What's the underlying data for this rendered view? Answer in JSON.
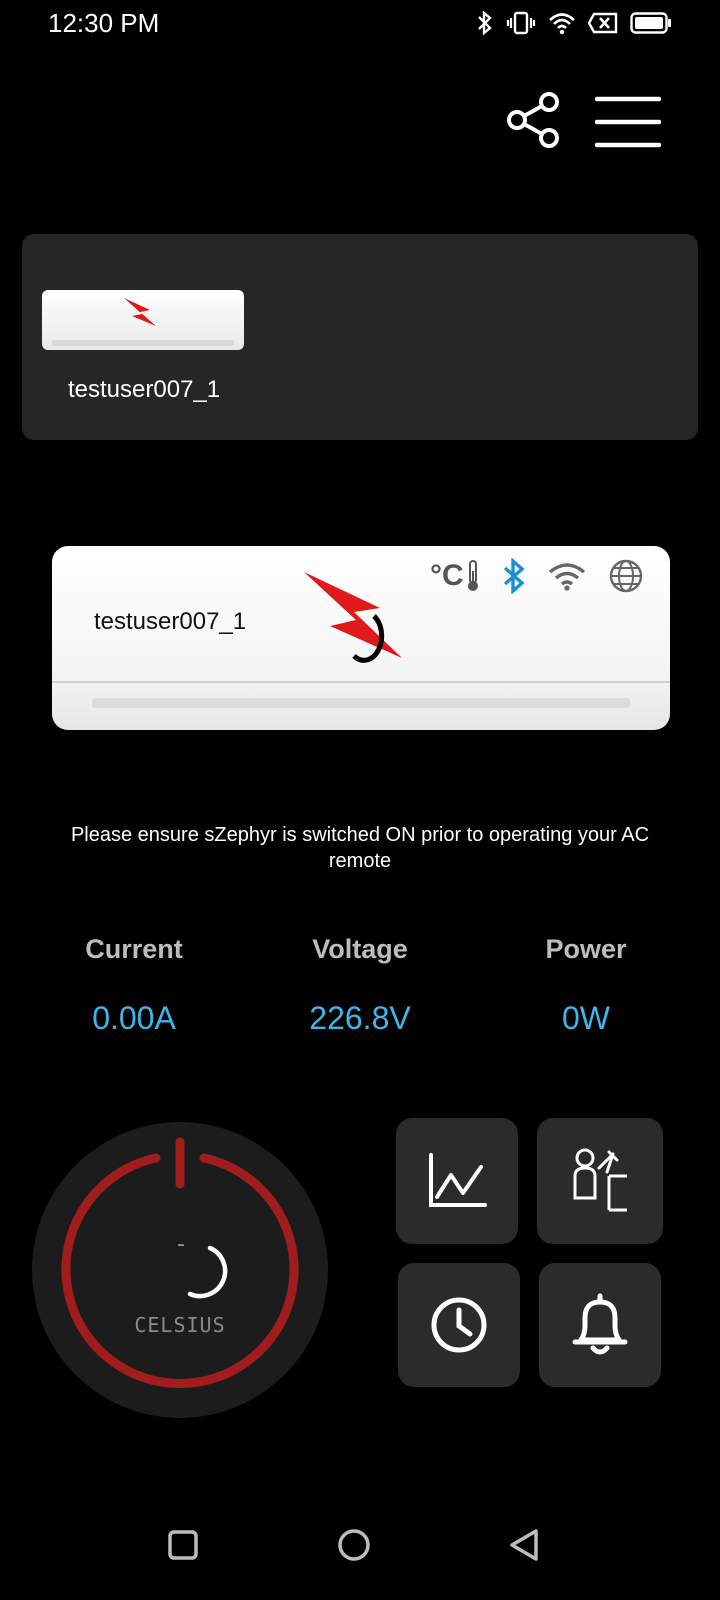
{
  "status_bar": {
    "time": "12:30 PM"
  },
  "device_card": {
    "name": "testuser007_1"
  },
  "ac_display": {
    "name": "testuser007_1",
    "temp_unit_symbol": "°C"
  },
  "notice": "Please ensure sZephyr is switched ON prior to operating your AC remote",
  "metrics": [
    {
      "label": "Current",
      "value": "0.00A"
    },
    {
      "label": "Voltage",
      "value": "226.8V"
    },
    {
      "label": "Power",
      "value": "0W"
    }
  ],
  "dial": {
    "temperature": "-",
    "unit_label": "CELSIUS"
  },
  "colors": {
    "accent": "#3fb6ea",
    "dial_ring": "#a11d1d",
    "card_bg": "#262626",
    "tile_bg": "#2b2b2b",
    "bluetooth": "#1a8fd6",
    "brand_red": "#e0191b"
  },
  "icons": [
    "share-icon",
    "menu-icon",
    "chart-icon",
    "maintenance-icon",
    "clock-icon",
    "bell-icon",
    "bluetooth-icon",
    "wifi-icon",
    "globe-icon",
    "thermometer-icon"
  ]
}
